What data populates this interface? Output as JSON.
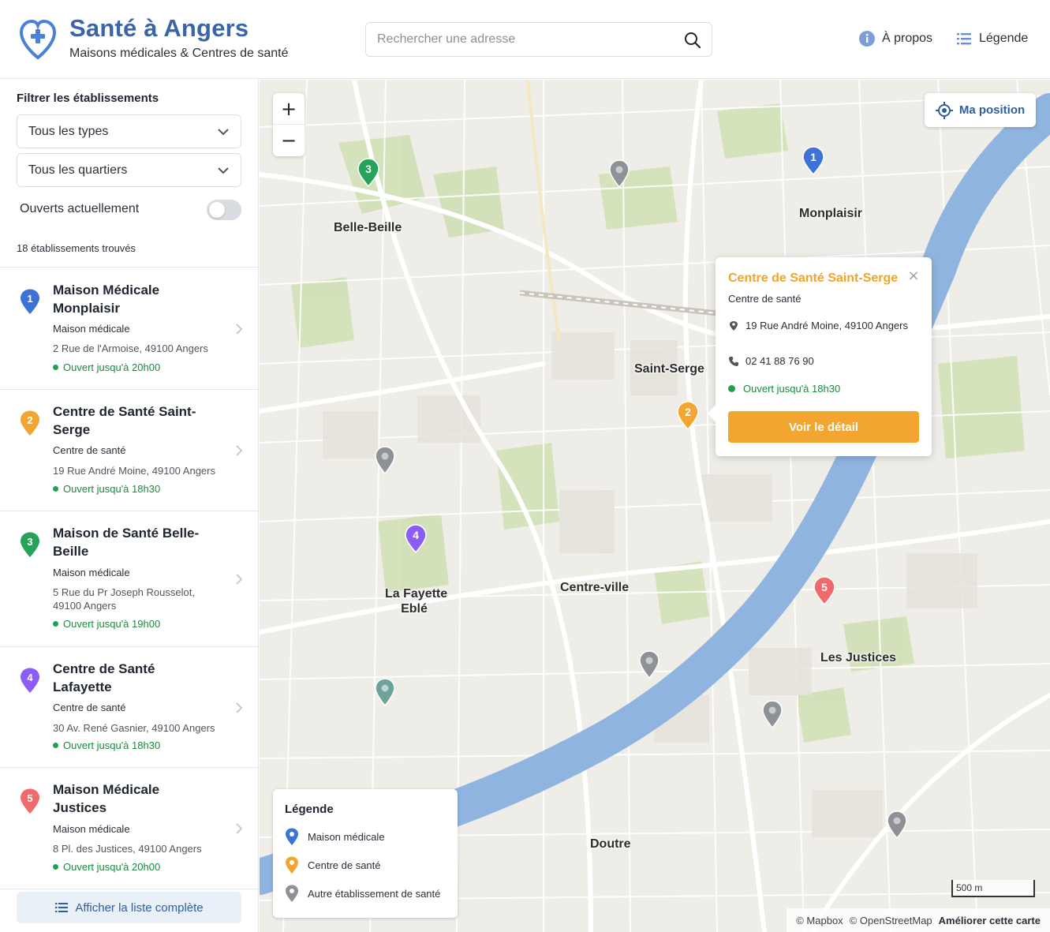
{
  "header": {
    "title": "Santé à Angers",
    "subtitle": "Maisons médicales & Centres de santé",
    "search_placeholder": "Rechercher une adresse",
    "about_label": "À propos",
    "legend_label": "Légende"
  },
  "sidebar": {
    "filter_title": "Filtrer les établissements",
    "type_select": "Tous les types",
    "district_select": "Tous les quartiers",
    "open_now_label": "Ouverts actuellement",
    "open_now_on": false,
    "results_count": "18 établissements trouvés",
    "items": [
      {
        "number": "1",
        "name": "Maison Médicale Monplaisir",
        "type": "Maison médicale",
        "address": "2 Rue de l'Armoise, 49100 Angers",
        "status": "Ouvert jusqu'à 20h00",
        "color": "#3d73d6"
      },
      {
        "number": "2",
        "name": "Centre de Santé Saint-Serge",
        "type": "Centre de santé",
        "address": "19 Rue André Moine, 49100 Angers",
        "status": "Ouvert jusqu'à 18h30",
        "color": "#f3a531"
      },
      {
        "number": "3",
        "name": "Maison de Santé Belle-Beille",
        "type": "Maison médicale",
        "address": "5 Rue du Pr Joseph Rousselot, 49100 Angers",
        "status": "Ouvert jusqu'à 19h00",
        "color": "#25a35a"
      },
      {
        "number": "4",
        "name": "Centre de Santé Lafayette",
        "type": "Centre de santé",
        "address": "30 Av. René Gasnier, 49100 Angers",
        "status": "Ouvert jusqu'à 18h30",
        "color": "#8b5cf6"
      },
      {
        "number": "5",
        "name": "Maison Médicale Justices",
        "type": "Maison médicale",
        "address": "8 Pl. des Justices, 49100 Angers",
        "status": "Ouvert jusqu'à 20h00",
        "color": "#ef6b6b"
      }
    ],
    "full_list_button": "Afficher la liste complète"
  },
  "map": {
    "zoom_in": "+",
    "zoom_out": "−",
    "my_position": "Ma position",
    "places": {
      "belle_beille": "Belle-Beille",
      "monplaisir": "Monplaisir",
      "saint_serge": "Saint-Serge",
      "centre_ville": "Centre-ville",
      "la_fayette": "La Fayette",
      "eble": "Eblé",
      "les_justices": "Les Justices",
      "doutre": "Doutre"
    },
    "popup": {
      "title": "Centre de Santé Saint-Serge",
      "close": "×",
      "type": "Centre de santé",
      "address": "19 Rue André Moine, 49100 Angers",
      "phone": "02 41 88 76 90",
      "status": "Ouvert jusqu'à 18h30",
      "button": "Voir le détail"
    },
    "legend": {
      "title": "Légende",
      "items": [
        {
          "label": "Maison médicale",
          "color": "#3d73d6"
        },
        {
          "label": "Centre de santé",
          "color": "#f3a531"
        },
        {
          "label": "Autre établissement de santé",
          "color": "#8e9297"
        }
      ]
    },
    "scale_label": "500 m",
    "attribution": {
      "mapbox": "© Mapbox",
      "osm": "© OpenStreetMap",
      "improve": "Améliorer cette carte"
    }
  },
  "colors": {
    "brand": "#3a65a8",
    "accent": "#f3a531",
    "open_status": "#22a04b",
    "river": "#8fb4e0",
    "park": "#cfe0b4"
  },
  "icons": [
    "heart-plus-logo-icon",
    "search-icon",
    "info-icon",
    "list-icon",
    "chevron-down-icon",
    "chevron-right-icon",
    "locate-icon",
    "pin-icon",
    "phone-icon",
    "close-icon"
  ]
}
